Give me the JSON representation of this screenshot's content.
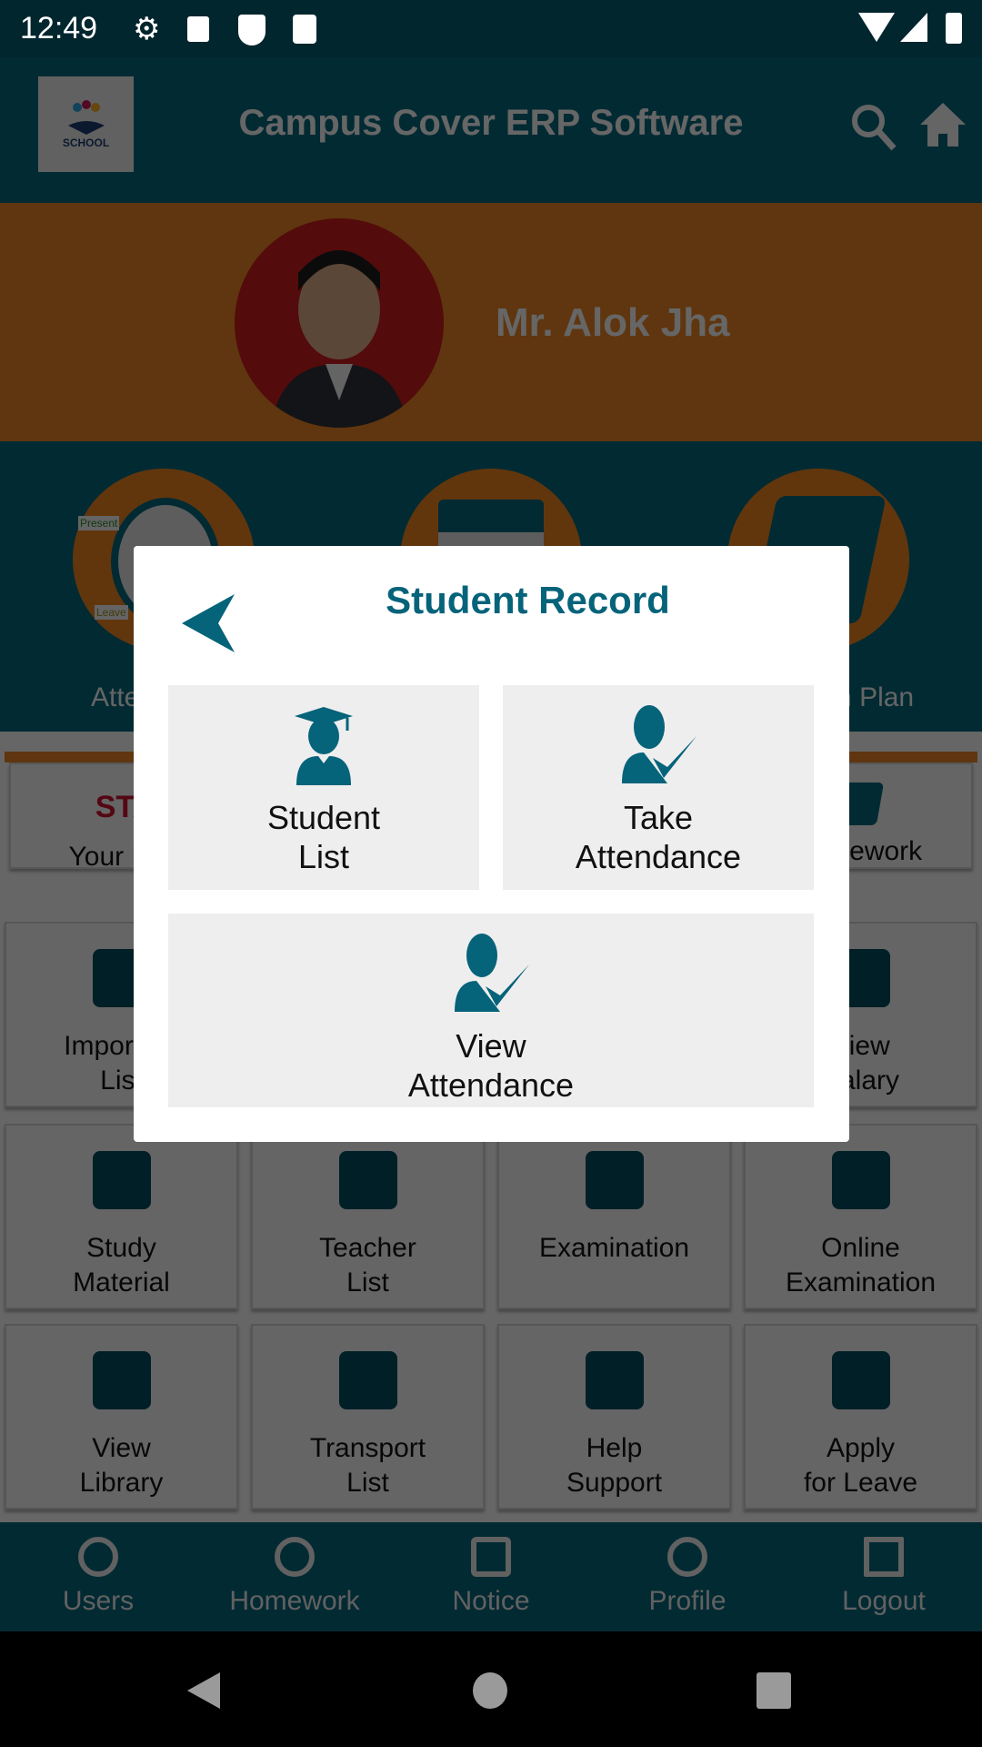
{
  "status_bar": {
    "time": "12:49",
    "icons": [
      "gear-icon",
      "a-icon",
      "shield-play-icon",
      "sd-card-icon",
      "wifi-icon",
      "signal-icon",
      "battery-icon"
    ]
  },
  "app_bar": {
    "logo_text": "SCHOOL",
    "title": "Campus Cover ERP Software",
    "icons": [
      "search-icon",
      "home-icon"
    ]
  },
  "profile": {
    "name": "Mr. Alok Jha"
  },
  "quick": [
    {
      "label": "Attendance",
      "badges": [
        "Present",
        "Leave"
      ]
    },
    {
      "label": ""
    },
    {
      "label": "Lesson Plan"
    }
  ],
  "top_cards": [
    {
      "title": "STA",
      "label": "Your Live"
    },
    {
      "label": "Homework"
    }
  ],
  "grid": [
    {
      "label": "Important\nList"
    },
    {
      "label": ""
    },
    {
      "label": ""
    },
    {
      "label": "View\nSalary"
    },
    {
      "label": "Study\nMaterial"
    },
    {
      "label": "Teacher\nList"
    },
    {
      "label": "Examination"
    },
    {
      "label": "Online\nExamination"
    },
    {
      "label": "View\nLibrary"
    },
    {
      "label": "Transport\nList"
    },
    {
      "label": "Help\nSupport"
    },
    {
      "label": "Apply\nfor Leave"
    }
  ],
  "bottom_nav": [
    {
      "label": "Users"
    },
    {
      "label": "Homework"
    },
    {
      "label": "Notice"
    },
    {
      "label": "Profile"
    },
    {
      "label": "Logout"
    }
  ],
  "dialog": {
    "title": "Student Record",
    "tiles": [
      {
        "label": "Student\nList",
        "icon": "graduate-icon"
      },
      {
        "label": "Take\nAttendance",
        "icon": "user-check-icon"
      },
      {
        "label": "View\nAttendance",
        "icon": "user-check-icon"
      }
    ]
  },
  "colors": {
    "primary": "#05637a",
    "accent": "#e38024",
    "dialog_title": "#05637a"
  }
}
